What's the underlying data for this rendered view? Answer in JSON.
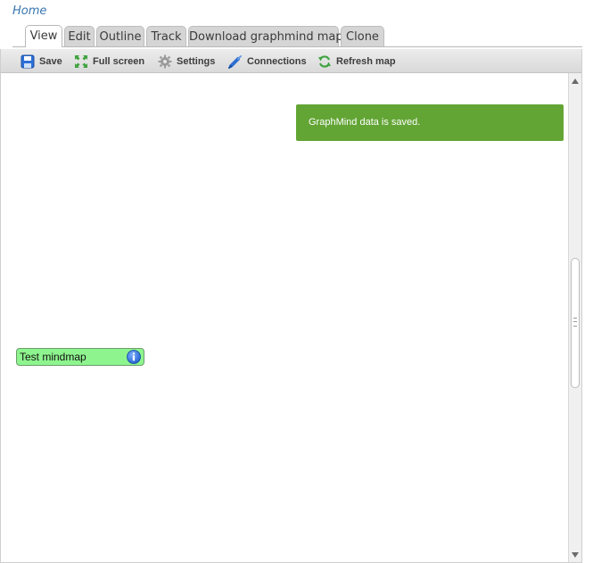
{
  "breadcrumb": {
    "home": "Home"
  },
  "tabs": [
    {
      "label": "View",
      "active": true
    },
    {
      "label": "Edit"
    },
    {
      "label": "Outline"
    },
    {
      "label": "Track"
    },
    {
      "label": "Download graphmind map"
    },
    {
      "label": "Clone"
    }
  ],
  "toolbar": {
    "save": {
      "label": "Save",
      "icon": "floppy-disk-icon"
    },
    "fullscreen": {
      "label": "Full screen",
      "icon": "expand-arrows-icon"
    },
    "settings": {
      "label": "Settings",
      "icon": "gear-icon"
    },
    "connections": {
      "label": "Connections",
      "icon": "connector-icon"
    },
    "refresh": {
      "label": "Refresh map",
      "icon": "refresh-icon"
    }
  },
  "notice": {
    "text": "GraphMind data is saved.",
    "color": "#63a535"
  },
  "mindmap": {
    "root_node": {
      "label": "Test mindmap",
      "color": "#8ef58e",
      "icon": "info-icon"
    }
  },
  "colors": {
    "link": "#3a76b0",
    "accent_blue": "#1f5fcf"
  }
}
